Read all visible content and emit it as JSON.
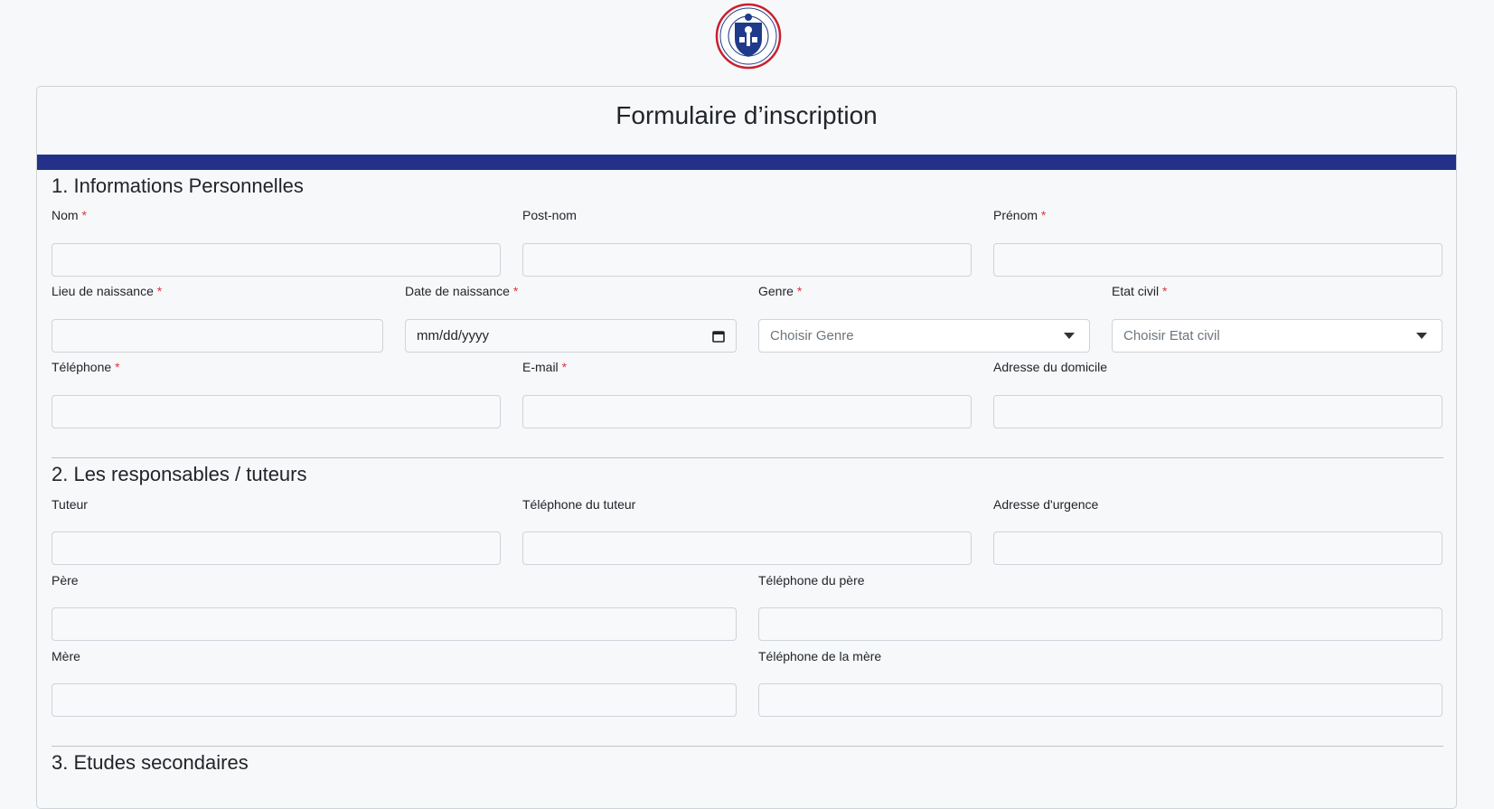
{
  "logo": {
    "ring_text_top": "UNIVERSITÉ PROTESTANTE DE LUBUMBASHI",
    "ring_text_bottom": "VERITÉ ET LIBERTÉ"
  },
  "form": {
    "title": "Formulaire d’inscription",
    "required_mark": "*",
    "section1": {
      "title": "1. Informations Personnelles",
      "nom": "Nom",
      "postnom": "Post-nom",
      "prenom": "Prénom",
      "lieu_naissance": "Lieu de naissance",
      "date_naissance": "Date de naissance",
      "date_placeholder": "mm/dd/yyyy",
      "genre": "Genre",
      "genre_placeholder": "Choisir Genre",
      "etat_civil": "Etat civil",
      "etat_civil_placeholder": "Choisir Etat civil",
      "telephone": "Téléphone",
      "email": "E-mail",
      "adresse": "Adresse du domicile"
    },
    "section2": {
      "title": "2. Les responsables / tuteurs",
      "tuteur": "Tuteur",
      "tel_tuteur": "Téléphone du tuteur",
      "adresse_urgence": "Adresse d'urgence",
      "pere": "Père",
      "tel_pere": "Téléphone du père",
      "mere": "Mère",
      "tel_mere": "Téléphone de la mère"
    },
    "section3": {
      "title": "3. Etudes secondaires"
    }
  },
  "colors": {
    "band": "#233288",
    "required": "#dc3545",
    "logo_red": "#c8202f",
    "logo_blue": "#1f3a8a"
  }
}
